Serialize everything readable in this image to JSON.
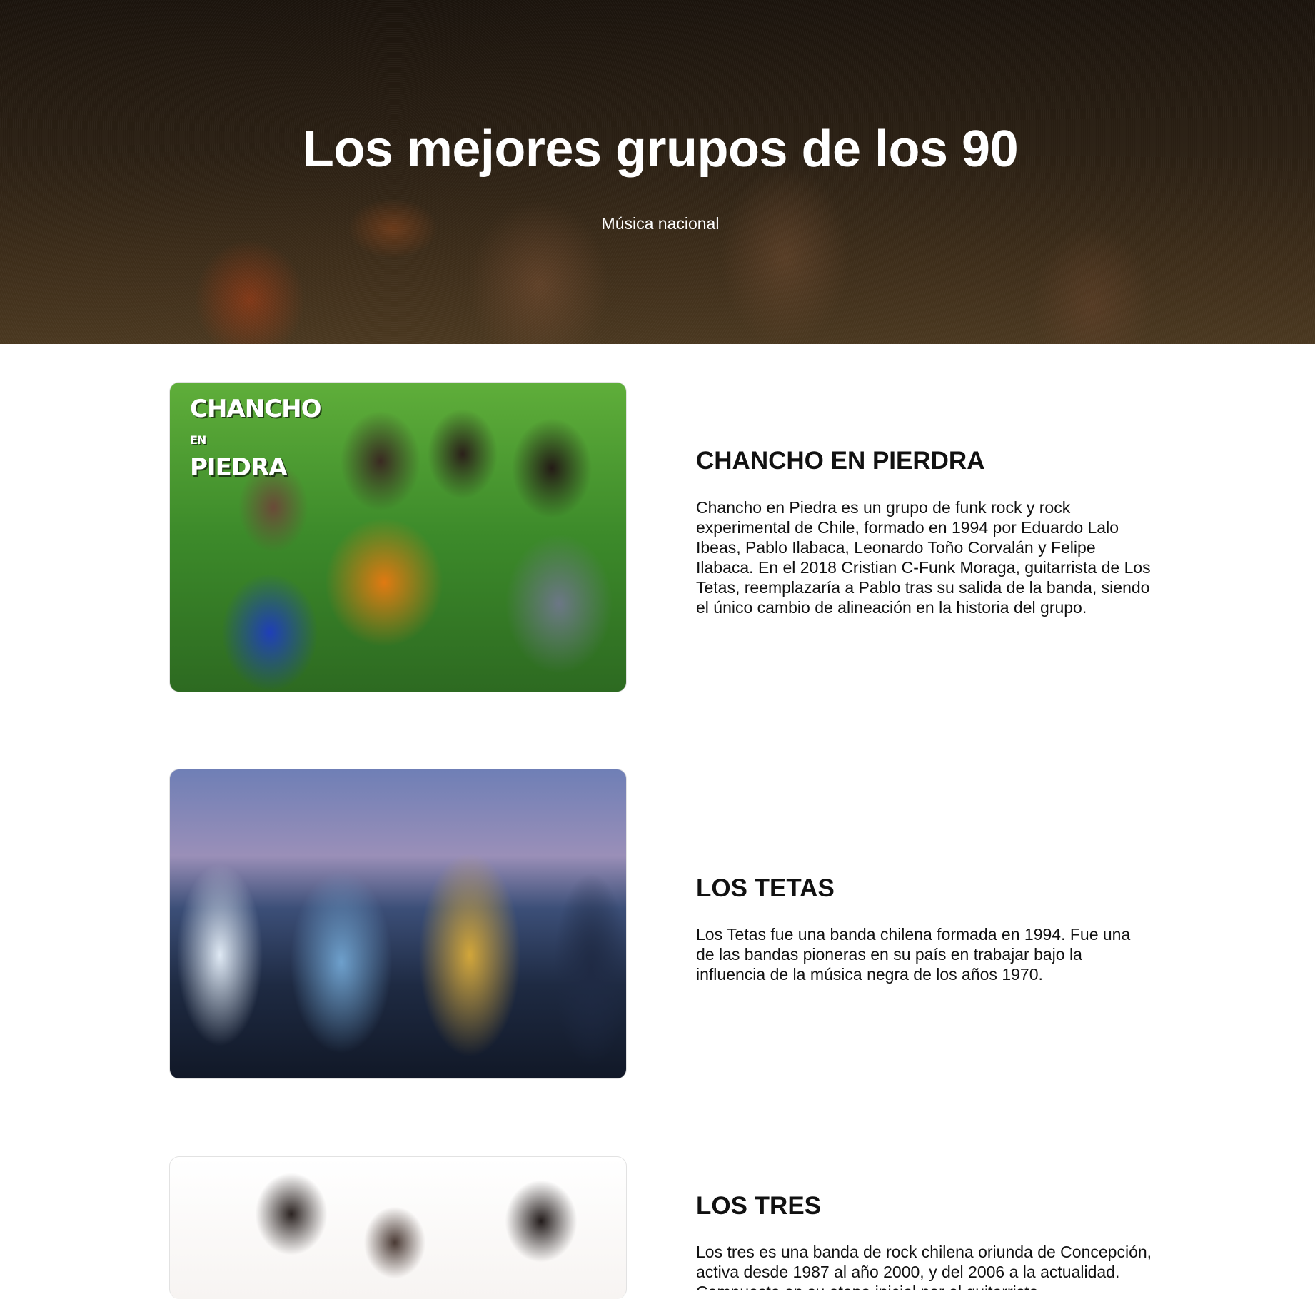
{
  "hero": {
    "title": "Los mejores grupos de los 90",
    "subtitle": "Música nacional"
  },
  "bands": [
    {
      "name": "CHANCHO EN PIERDRA",
      "logo_text": "CHANCHO EN PIEDRA",
      "description": "Chancho en Piedra es un grupo de funk rock y rock experimental de Chile, formado en 1994 por Eduardo Lalo Ibeas, Pablo Ilabaca, Leonardo Toño Corvalán y Felipe Ilabaca. En el 2018 Cristian C-Funk Moraga, guitarrista de Los Tetas, reemplazaría a Pablo tras su salida de la banda, siendo el único cambio de alineación en la historia del grupo."
    },
    {
      "name": "LOS TETAS",
      "description": "Los Tetas fue una banda chilena formada en 1994. Fue una de las bandas pioneras en su país en trabajar bajo la influencia de la música negra de los años 1970."
    },
    {
      "name": "LOS TRES",
      "description": "Los tres es una banda de rock chilena oriunda de Concepción, activa desde 1987 al año 2000, y del 2006 a la actualidad. Compuesta en su etapa inicial por el guitarrista"
    }
  ]
}
